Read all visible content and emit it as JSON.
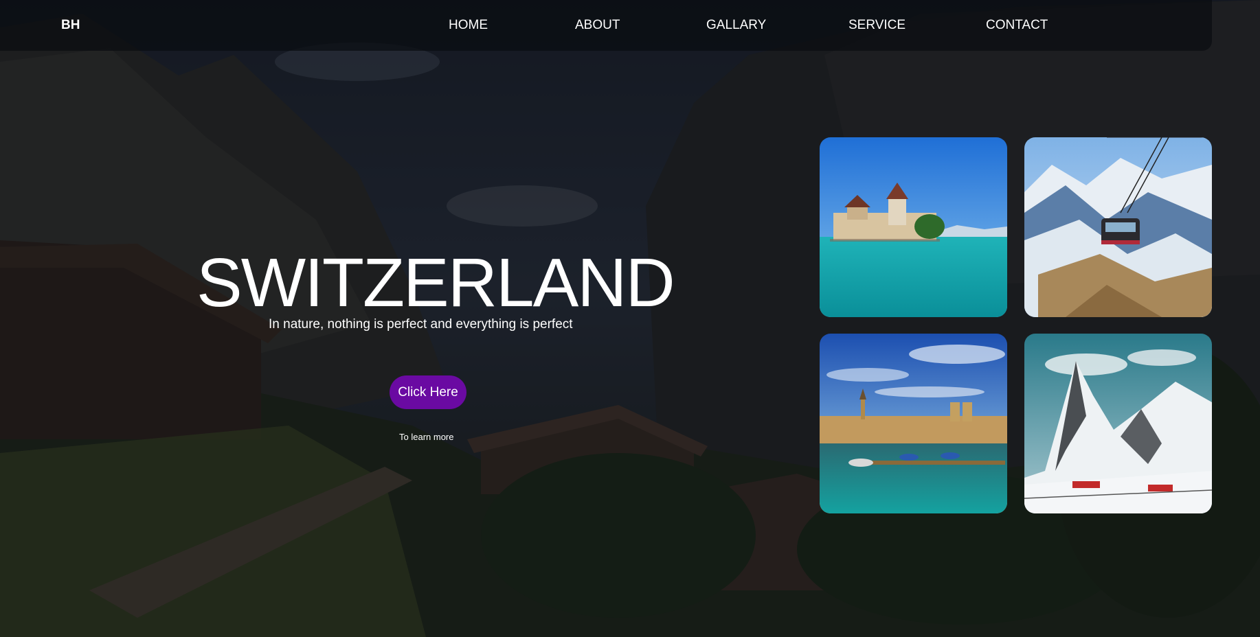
{
  "brand": {
    "logo": "BH"
  },
  "nav": {
    "items": [
      {
        "label": "HOME"
      },
      {
        "label": "ABOUT"
      },
      {
        "label": "GALLARY"
      },
      {
        "label": "SERVICE"
      },
      {
        "label": "CONTACT"
      }
    ]
  },
  "hero": {
    "title": "SWITZERLAND",
    "subtitle": "In nature, nothing is perfect and everything is perfect",
    "cta_label": "Click Here",
    "cta_caption": "To learn more"
  },
  "gallery": {
    "items": [
      {
        "name": "lakeside castle"
      },
      {
        "name": "cable car over mountains"
      },
      {
        "name": "city harbor"
      },
      {
        "name": "snowy peak with train"
      }
    ]
  },
  "colors": {
    "accent": "#6a0aa2",
    "overlay": "#0a0c10"
  }
}
